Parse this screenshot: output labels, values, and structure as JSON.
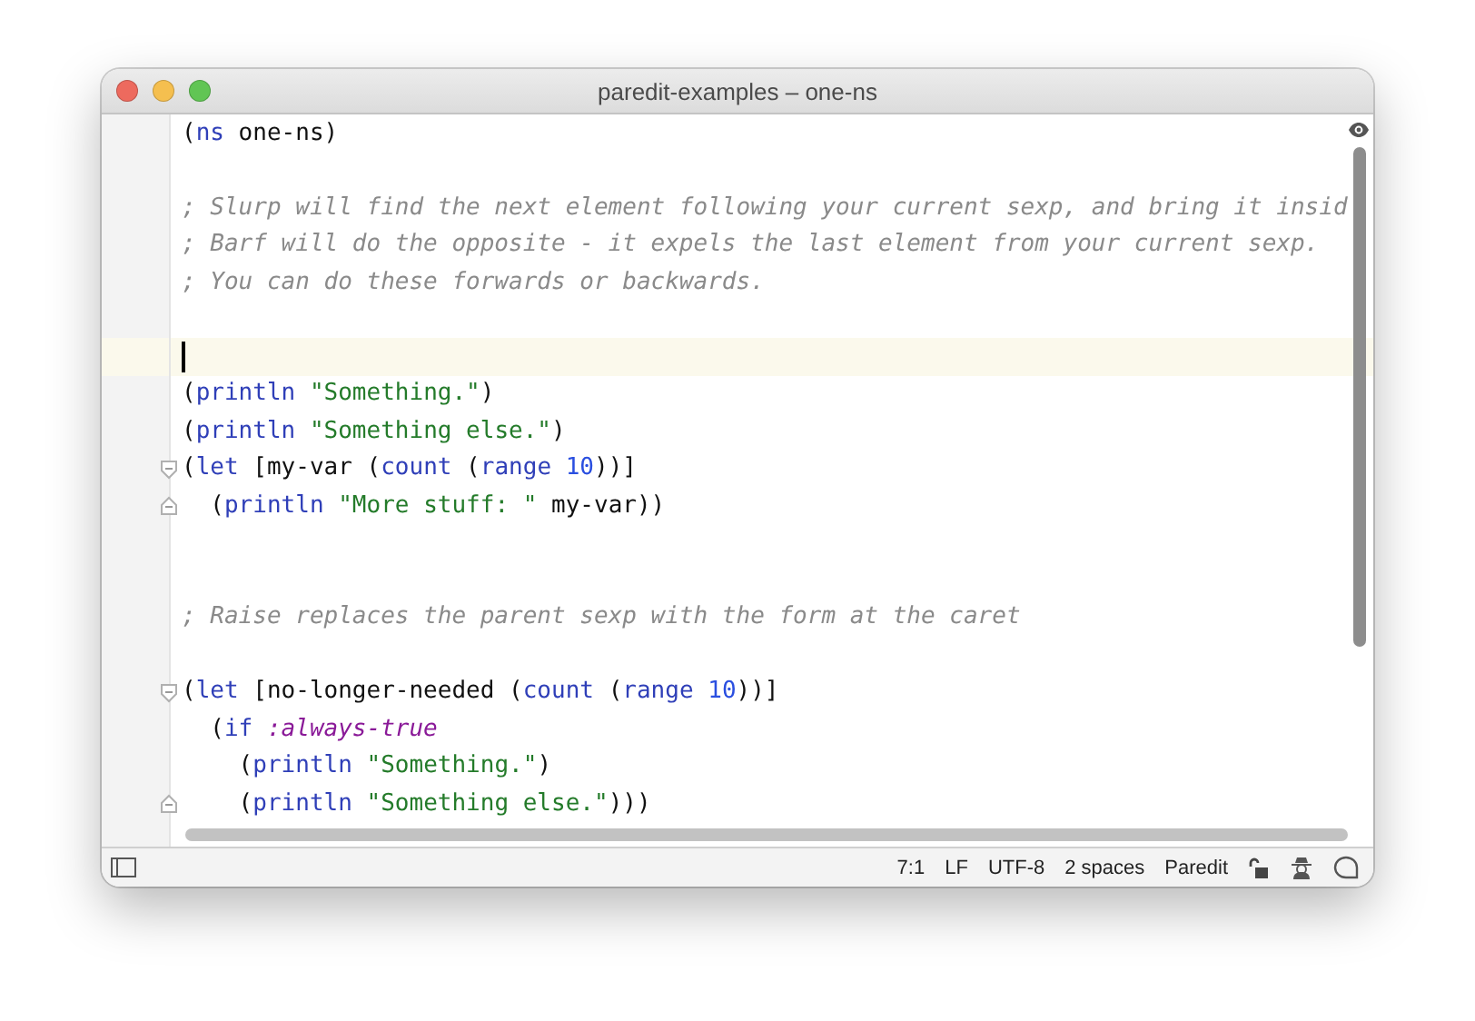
{
  "window": {
    "title": "paredit-examples – one-ns"
  },
  "lines": [
    {
      "kind": "code",
      "tokens": [
        {
          "kind": "paren",
          "text": "("
        },
        {
          "kind": "keyword",
          "text": "ns"
        },
        {
          "kind": "plain",
          "text": " one-ns)"
        }
      ]
    },
    {
      "kind": "blank"
    },
    {
      "kind": "code",
      "tokens": [
        {
          "kind": "comment",
          "text": "; Slurp will find the next element following your current sexp, and bring it insid"
        }
      ]
    },
    {
      "kind": "code",
      "tokens": [
        {
          "kind": "comment",
          "text": "; Barf will do the opposite - it expels the last element from your current sexp."
        }
      ]
    },
    {
      "kind": "code",
      "tokens": [
        {
          "kind": "comment",
          "text": "; You can do these forwards or backwards."
        }
      ]
    },
    {
      "kind": "blank"
    },
    {
      "kind": "blank",
      "current": true
    },
    {
      "kind": "code",
      "tokens": [
        {
          "kind": "plain",
          "text": "("
        },
        {
          "kind": "keyword",
          "text": "println"
        },
        {
          "kind": "string",
          "text": " \"Something.\""
        },
        {
          "kind": "plain",
          "text": ")"
        }
      ]
    },
    {
      "kind": "code",
      "tokens": [
        {
          "kind": "plain",
          "text": "("
        },
        {
          "kind": "keyword",
          "text": "println"
        },
        {
          "kind": "string",
          "text": " \"Something else.\""
        },
        {
          "kind": "plain",
          "text": ")"
        }
      ]
    },
    {
      "kind": "code",
      "fold_start": true,
      "tokens": [
        {
          "kind": "plain",
          "text": "("
        },
        {
          "kind": "keyword",
          "text": "let"
        },
        {
          "kind": "plain",
          "text": " [my-var ("
        },
        {
          "kind": "keyword",
          "text": "count"
        },
        {
          "kind": "plain",
          "text": " ("
        },
        {
          "kind": "keyword",
          "text": "range"
        },
        {
          "kind": "number",
          "text": " 10"
        },
        {
          "kind": "plain",
          "text": "))]"
        }
      ]
    },
    {
      "kind": "code",
      "fold_end": true,
      "tokens": [
        {
          "kind": "plain",
          "text": "  ("
        },
        {
          "kind": "keyword",
          "text": "println"
        },
        {
          "kind": "string",
          "text": " \"More stuff: \""
        },
        {
          "kind": "plain",
          "text": " my-var))"
        }
      ]
    },
    {
      "kind": "blank"
    },
    {
      "kind": "blank"
    },
    {
      "kind": "code",
      "tokens": [
        {
          "kind": "comment",
          "text": "; Raise replaces the parent sexp with the form at the caret"
        }
      ]
    },
    {
      "kind": "blank"
    },
    {
      "kind": "code",
      "fold_start": true,
      "tokens": [
        {
          "kind": "plain",
          "text": "("
        },
        {
          "kind": "keyword",
          "text": "let"
        },
        {
          "kind": "plain",
          "text": " [no-longer-needed ("
        },
        {
          "kind": "keyword",
          "text": "count"
        },
        {
          "kind": "plain",
          "text": " ("
        },
        {
          "kind": "keyword",
          "text": "range"
        },
        {
          "kind": "number",
          "text": " 10"
        },
        {
          "kind": "plain",
          "text": "))]"
        }
      ]
    },
    {
      "kind": "code",
      "tokens": [
        {
          "kind": "plain",
          "text": "  ("
        },
        {
          "kind": "keyword",
          "text": "if"
        },
        {
          "kind": "symbol",
          "text": " :always-true"
        }
      ]
    },
    {
      "kind": "code",
      "tokens": [
        {
          "kind": "plain",
          "text": "    ("
        },
        {
          "kind": "keyword",
          "text": "println"
        },
        {
          "kind": "string",
          "text": " \"Something.\""
        },
        {
          "kind": "plain",
          "text": ")"
        }
      ]
    },
    {
      "kind": "code",
      "fold_end": true,
      "tokens": [
        {
          "kind": "plain",
          "text": "    ("
        },
        {
          "kind": "keyword",
          "text": "println"
        },
        {
          "kind": "string",
          "text": " \"Something else.\""
        },
        {
          "kind": "plain",
          "text": ")))"
        }
      ]
    }
  ],
  "status_bar": {
    "items": [
      "7:1",
      "LF",
      "UTF-8",
      "2 spaces",
      "Paredit"
    ]
  }
}
